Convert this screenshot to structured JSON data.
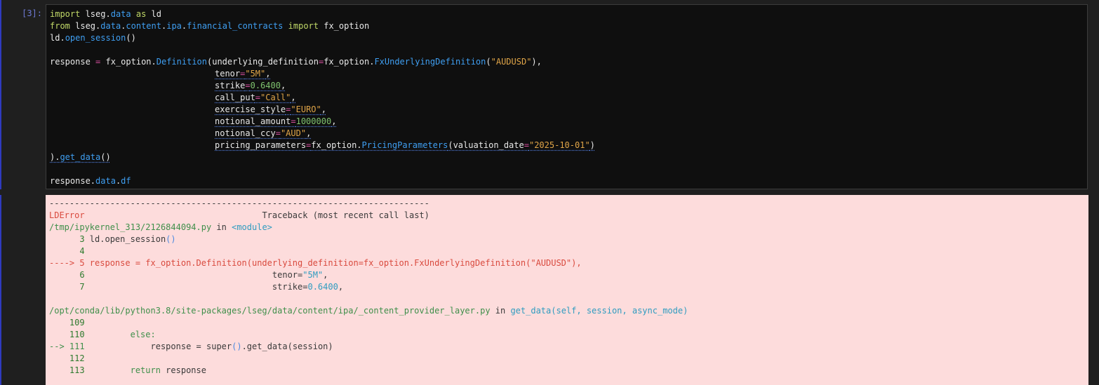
{
  "cell": {
    "prompt": "[3]:",
    "code": {
      "l1": {
        "a": "import",
        "b": " lseg.",
        "c": "data",
        "d": " as",
        "e": " ld"
      },
      "l2": {
        "a": "from",
        "b": " lseg.",
        "c": "data",
        "d": ".",
        "e": "content",
        "f": ".",
        "g": "ipa",
        "h": ".",
        "i": "financial_contracts",
        "j": " import",
        "k": " fx_option"
      },
      "l3": {
        "a": "ld.",
        "b": "open_session",
        "c": "()"
      },
      "l5": {
        "a": "response ",
        "b": "=",
        "c": " fx_option.",
        "d": "Definition",
        "e": "(underlying_definition",
        "f": "=",
        "g": "fx_option.",
        "h": "FxUnderlyingDefinition",
        "i": "(",
        "j": "\"AUDUSD\"",
        "k": "),"
      },
      "l6": {
        "a": "tenor",
        "b": "=",
        "c": "\"5M\"",
        "d": ","
      },
      "l7": {
        "a": "strike",
        "b": "=",
        "c": "0.6400",
        "d": ","
      },
      "l8": {
        "a": "call_put",
        "b": "=",
        "c": "\"Call\"",
        "d": ","
      },
      "l9": {
        "a": "exercise_style",
        "b": "=",
        "c": "\"EURO\"",
        "d": ","
      },
      "l10": {
        "a": "notional_amount",
        "b": "=",
        "c": "1000000",
        "d": ","
      },
      "l11": {
        "a": "notional_ccy",
        "b": "=",
        "c": "\"AUD\"",
        "d": ","
      },
      "l12": {
        "a": "pricing_parameters",
        "b": "=",
        "c": "fx_option.",
        "d": "PricingParameters",
        "e": "(valuation_date",
        "f": "=",
        "g": "\"2025-10-01\"",
        "h": ")"
      },
      "l13": {
        "a": ").",
        "b": "get_data",
        "c": "()"
      },
      "l15": {
        "a": "response.",
        "b": "data",
        "c": ".",
        "d": "df"
      }
    }
  },
  "output": {
    "dashes": "---------------------------------------------------------------------------",
    "error_name": "LDError",
    "traceback_label": "Traceback (most recent call last)",
    "frame1": {
      "path": "/tmp/ipykernel_313/2126844094.py",
      "in": " in ",
      "module": "<module>"
    },
    "f1l3": {
      "num": "      3 ",
      "a": "ld.open_session",
      "b": "()"
    },
    "f1l4": {
      "num": "      4"
    },
    "f1l5": {
      "arrow": "----> 5 ",
      "text": "response = fx_option.Definition(underlying_definition=fx_option.FxUnderlyingDefinition(\"AUDUSD\"),"
    },
    "f1l6": {
      "num": "      6 ",
      "indent": "                                    ",
      "a": "tenor",
      "b": "=",
      "c": "\"5M\"",
      "d": ","
    },
    "f1l7": {
      "num": "      7 ",
      "indent": "                                    ",
      "a": "strike",
      "b": "=",
      "c": "0.6400",
      "d": ","
    },
    "frame2": {
      "path": "/opt/conda/lib/python3.8/site-packages/lseg/data/content/ipa/_content_provider_layer.py",
      "in": " in ",
      "func": "get_data(self, session, async_mode)"
    },
    "f2l109": {
      "num": "    109"
    },
    "f2l110": {
      "num": "    110 ",
      "indent": "        ",
      "kw": "else:"
    },
    "f2l111": {
      "arrow": "--> 111 ",
      "indent": "            ",
      "a": "response ",
      "b": "=",
      "c": " super",
      "d": "()",
      ".e": "",
      "e": ".get_data",
      "f": "(session)"
    },
    "f2l112": {
      "num": "    112"
    },
    "f2l113": {
      "num": "    113 ",
      "indent": "        ",
      "kw": "return",
      "a": " response"
    }
  },
  "colors": {
    "accent": "#2f3bbf",
    "error_bg": "#fddcdc",
    "code_bg": "#0f0f0f"
  }
}
